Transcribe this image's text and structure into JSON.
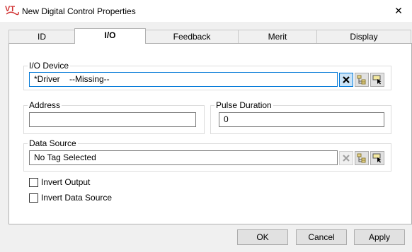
{
  "window": {
    "title": "New Digital Control Properties",
    "close_glyph": "✕",
    "logo_text": "VT"
  },
  "tabs": [
    {
      "label": "ID"
    },
    {
      "label": "I/O",
      "active": true
    },
    {
      "label": "Feedback"
    },
    {
      "label": "Merit"
    },
    {
      "label": "Display"
    }
  ],
  "io_device": {
    "label": "I/O Device",
    "value": "*Driver    --Missing--"
  },
  "address": {
    "label": "Address",
    "value": ""
  },
  "pulse_duration": {
    "label": "Pulse Duration",
    "value": "0"
  },
  "data_source": {
    "label": "Data Source",
    "value": "No Tag Selected"
  },
  "options": [
    {
      "label": "Invert Output",
      "checked": false
    },
    {
      "label": "Invert Data Source",
      "checked": false
    }
  ],
  "buttons": {
    "ok": "OK",
    "cancel": "Cancel",
    "apply": "Apply"
  },
  "icons": {
    "clear": "clear-icon",
    "tag_browser": "tag-browser-icon",
    "select_tag": "select-tag-icon"
  },
  "colors": {
    "logo_red": "#d03030",
    "focus_blue": "#0078d7"
  }
}
